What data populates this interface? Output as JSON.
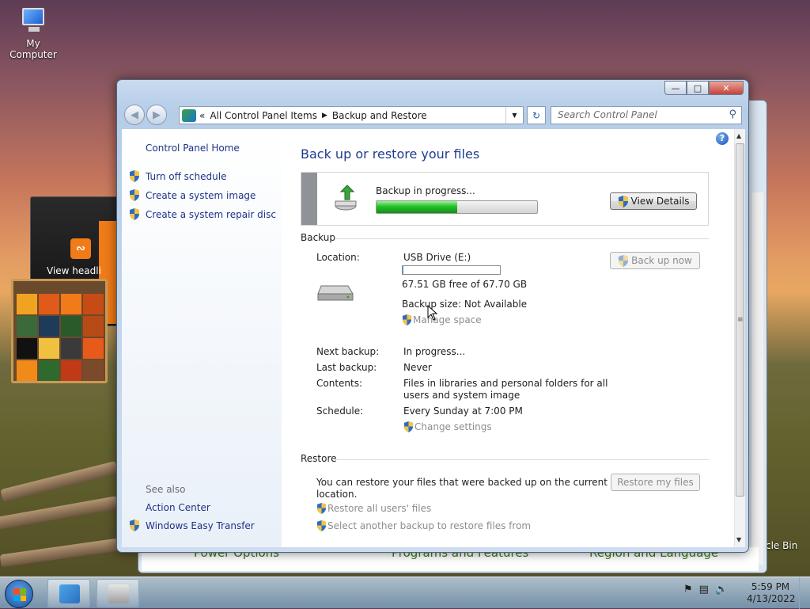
{
  "desktop": {
    "icon_label": "My Computer",
    "gadget_label": "View headli",
    "recycle_label": "cle Bin"
  },
  "back_window": {
    "items": [
      "Power Options",
      "Programs and Features",
      "Region and Language"
    ]
  },
  "window": {
    "controls": {
      "minimize": "—",
      "maximize": "□",
      "close": "✕"
    },
    "breadcrumb": {
      "overflow": "«",
      "items": [
        "All Control Panel Items",
        "Backup and Restore"
      ],
      "separator": "▶"
    },
    "search_placeholder": "Search Control Panel"
  },
  "left_pane": {
    "home": "Control Panel Home",
    "tasks": [
      "Turn off schedule",
      "Create a system image",
      "Create a system repair disc"
    ],
    "see_also_heading": "See also",
    "see_also": [
      "Action Center",
      "Windows Easy Transfer"
    ]
  },
  "main": {
    "title": "Back up or restore your files",
    "progress": {
      "status": "Backup in progress...",
      "fraction": 0.5,
      "view_details": "View Details"
    },
    "backup_section": {
      "heading": "Backup",
      "location_label": "Location:",
      "location_value": "USB Drive (E:)",
      "disk_used_fraction": 0.003,
      "free_space": "67.51 GB free of 67.70 GB",
      "backup_size": "Backup size: Not Available",
      "manage_space": "Manage space",
      "back_up_now": "Back up now",
      "next_backup_label": "Next backup:",
      "next_backup_value": "In progress...",
      "last_backup_label": "Last backup:",
      "last_backup_value": "Never",
      "contents_label": "Contents:",
      "contents_value_line1": "Files in libraries and personal folders for all",
      "contents_value_line2": "users and system image",
      "schedule_label": "Schedule:",
      "schedule_value": "Every Sunday at 7:00 PM",
      "change_settings": "Change settings"
    },
    "restore_section": {
      "heading": "Restore",
      "description_line1": "You can restore your files that were backed up on the current",
      "description_line2": "location.",
      "restore_my_files": "Restore my files",
      "restore_all_users": "Restore all users' files",
      "select_another": "Select another backup to restore files from"
    }
  },
  "taskbar": {
    "time": "5:59 PM",
    "date": "4/13/2022"
  },
  "colors": {
    "link": "#1e3287",
    "title": "#1e3c8f",
    "progress_green": "#23c02a",
    "disabled_text": "#8d8d8d"
  }
}
